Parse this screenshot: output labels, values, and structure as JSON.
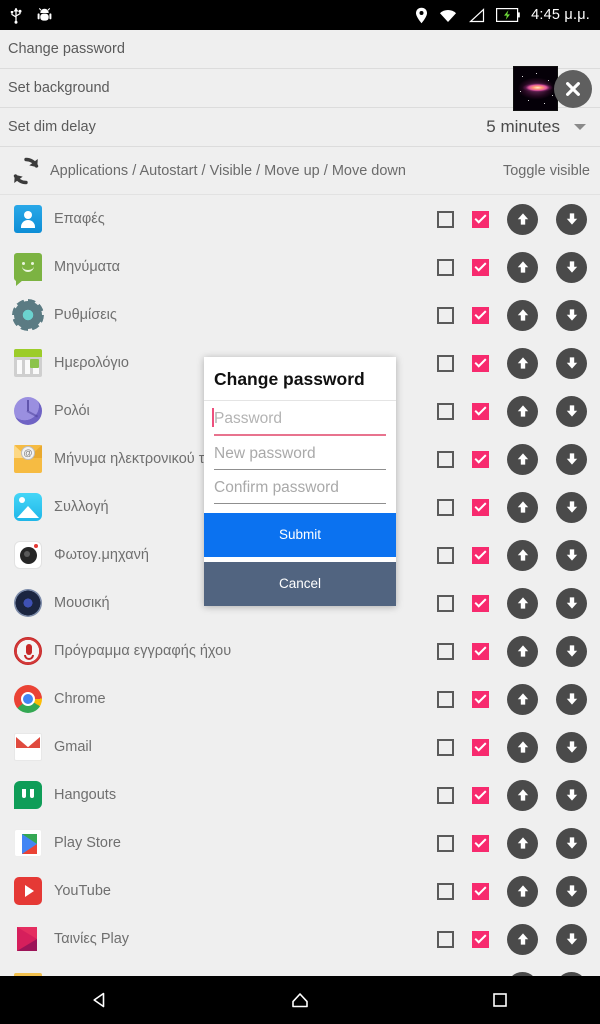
{
  "statusbar": {
    "icons_left": [
      "usb-icon",
      "android-debug-icon"
    ],
    "icons_right": [
      "location-icon",
      "wifi-icon",
      "signal-icon",
      "battery-charging-icon"
    ],
    "time": "4:45 μ.μ."
  },
  "settings": {
    "change_password_label": "Change password",
    "set_background_label": "Set background",
    "background_thumbnail_name": "galaxy-wallpaper-thumbnail",
    "clear_background_icon": "close-icon",
    "set_dim_delay_label": "Set dim delay",
    "dim_delay_value": "5 minutes"
  },
  "list_header": {
    "refresh_icon": "refresh-icon",
    "path": "Applications / Autostart / Visible / Move up / Move down",
    "toggle_visible_label": "Toggle visible"
  },
  "apps": [
    {
      "name": "Επαφές",
      "icon": "contacts-icon",
      "autostart": false,
      "visible": true
    },
    {
      "name": "Μηνύματα",
      "icon": "messages-icon",
      "autostart": false,
      "visible": true
    },
    {
      "name": "Ρυθμίσεις",
      "icon": "settings-icon",
      "autostart": false,
      "visible": true
    },
    {
      "name": "Ημερολόγιο",
      "icon": "calendar-icon",
      "autostart": false,
      "visible": true
    },
    {
      "name": "Ρολόι",
      "icon": "clock-icon",
      "autostart": false,
      "visible": true
    },
    {
      "name": "Μήνυμα ηλεκτρονικού τ",
      "icon": "email-icon",
      "autostart": false,
      "visible": true
    },
    {
      "name": "Συλλογή",
      "icon": "gallery-icon",
      "autostart": false,
      "visible": true
    },
    {
      "name": "Φωτογ.μηχανή",
      "icon": "camera-icon",
      "autostart": false,
      "visible": true
    },
    {
      "name": "Μουσική",
      "icon": "music-icon",
      "autostart": false,
      "visible": true
    },
    {
      "name": "Πρόγραμμα εγγραφής ήχου",
      "icon": "sound-recorder-icon",
      "autostart": false,
      "visible": true
    },
    {
      "name": "Chrome",
      "icon": "chrome-icon",
      "autostart": false,
      "visible": true
    },
    {
      "name": "Gmail",
      "icon": "gmail-icon",
      "autostart": false,
      "visible": true
    },
    {
      "name": "Hangouts",
      "icon": "hangouts-icon",
      "autostart": false,
      "visible": true
    },
    {
      "name": "Play Store",
      "icon": "play-store-icon",
      "autostart": false,
      "visible": true
    },
    {
      "name": "YouTube",
      "icon": "youtube-icon",
      "autostart": false,
      "visible": true
    },
    {
      "name": "Ταινίες Play",
      "icon": "play-movies-icon",
      "autostart": false,
      "visible": true
    }
  ],
  "row_controls": {
    "autostart_checkbox_name": "autostart-checkbox",
    "visible_checkbox_name": "visible-checkbox",
    "move_up_name": "move-up-button",
    "move_down_name": "move-down-button"
  },
  "dialog": {
    "title": "Change password",
    "fields": [
      {
        "placeholder": "Password",
        "value": "",
        "focused": true
      },
      {
        "placeholder": "New password",
        "value": "",
        "focused": false
      },
      {
        "placeholder": "Confirm password",
        "value": "",
        "focused": false
      }
    ],
    "submit_label": "Submit",
    "cancel_label": "Cancel"
  },
  "navbar": {
    "back_icon": "back-triangle-icon",
    "home_icon": "home-icon",
    "recents_icon": "recents-square-icon"
  },
  "colors": {
    "accent_pink": "#f72a6e",
    "submit_blue": "#0b72f0",
    "cancel_slate": "#516480",
    "background": "#efefef",
    "arrow_button": "#4a4a4a"
  }
}
